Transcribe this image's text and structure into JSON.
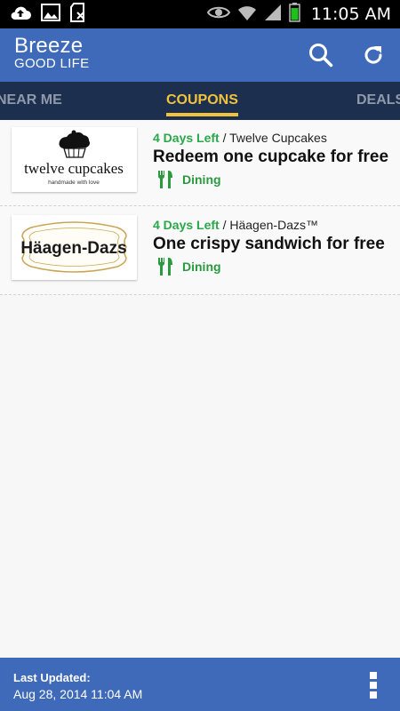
{
  "status_bar": {
    "time": "11:05 AM",
    "icons": [
      "cloud-upload-icon",
      "image-icon",
      "sd-card-blocked-icon",
      "eye-icon",
      "wifi-icon",
      "signal-icon",
      "battery-icon"
    ]
  },
  "app_bar": {
    "brand_name": "Breeze",
    "brand_sub": "GOOD LIFE",
    "actions": [
      "search-icon",
      "refresh-icon"
    ]
  },
  "tabs": [
    {
      "label": "NEAR ME",
      "active": false
    },
    {
      "label": "COUPONS",
      "active": true
    },
    {
      "label": "DEALS",
      "active": false
    }
  ],
  "coupons": [
    {
      "days_left": "4 Days Left",
      "separator": " / ",
      "merchant": "Twelve Cupcakes",
      "title": "Redeem one cupcake for free",
      "category": "Dining",
      "logo_text": "twelve cupcakes",
      "logo_tagline": "handmade with love"
    },
    {
      "days_left": "4 Days Left",
      "separator": " / ",
      "merchant": "Häagen-Dazs™",
      "title": "One crispy sandwich for free",
      "category": "Dining",
      "logo_text": "Häagen-Dazs"
    }
  ],
  "footer": {
    "label": "Last Updated:",
    "date": "Aug 28, 2014 11:04 AM"
  },
  "colors": {
    "brand_blue": "#3e6ab9",
    "tab_bar": "#1c2f4f",
    "active_tab": "#f2c23a",
    "days_left_green": "#2aa84a",
    "category_green": "#2a9a3f"
  }
}
